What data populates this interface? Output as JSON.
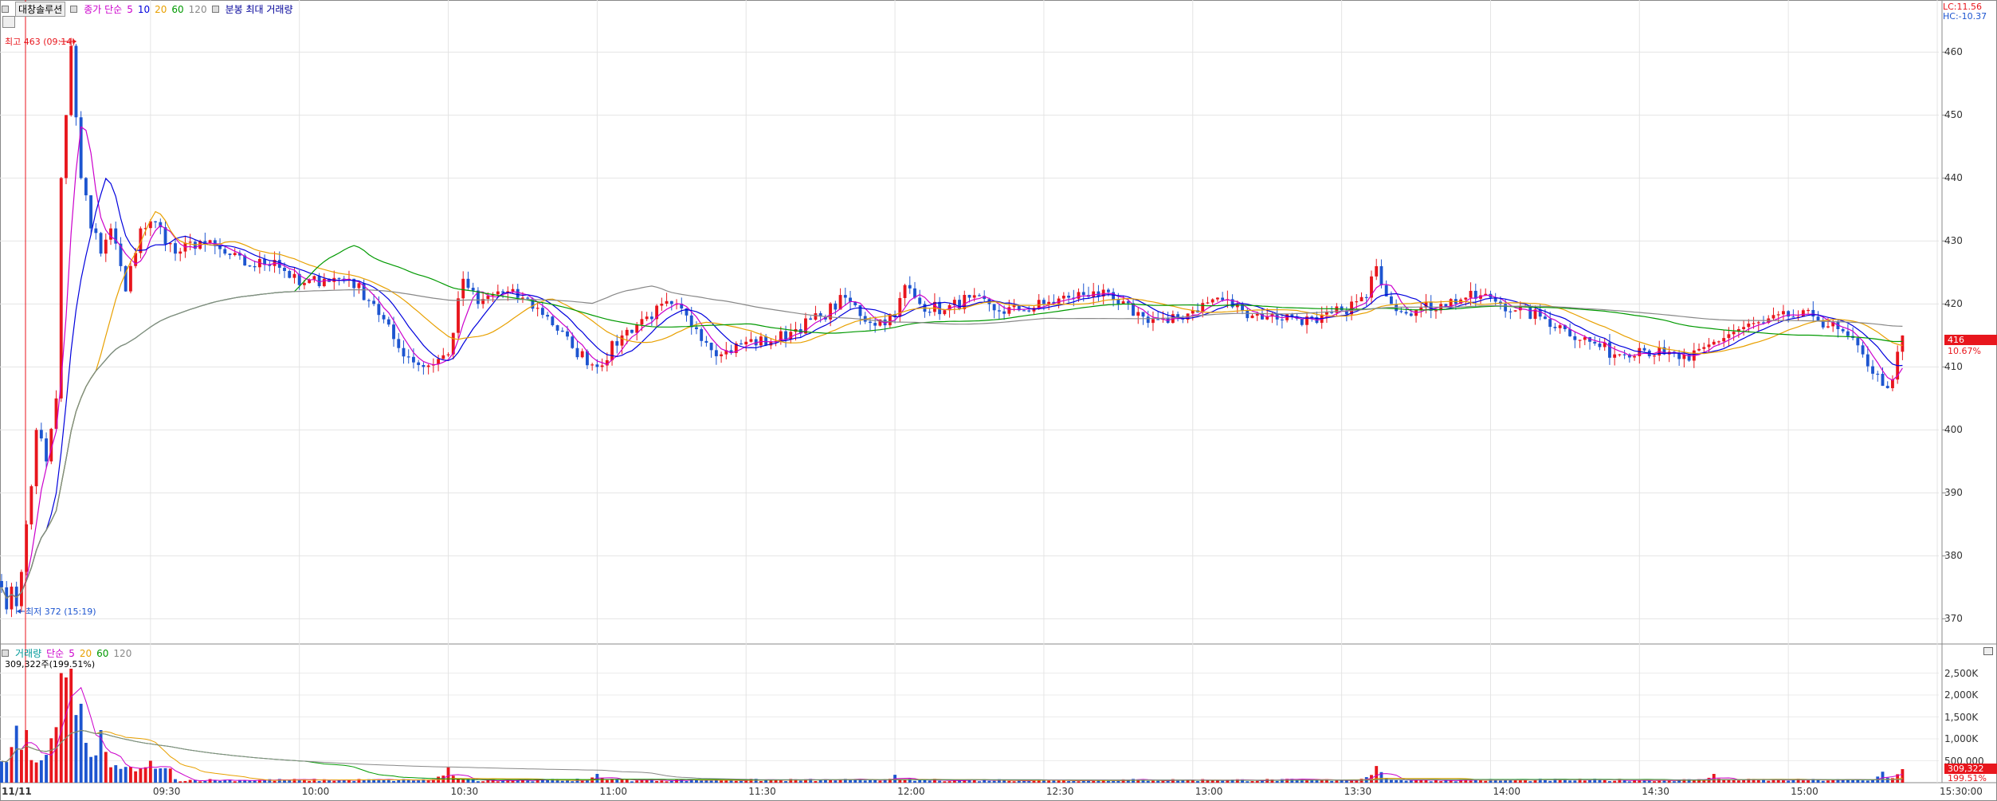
{
  "top_header": {
    "stock_name": "대창솔루션",
    "ma_label": "종가 단순",
    "ma_periods": [
      "5",
      "10",
      "20",
      "60",
      "120"
    ],
    "ma_colors": [
      "#cc00cc",
      "#0000dd",
      "#e8a000",
      "#009900",
      "#888888"
    ],
    "volume_option": "분봉 최대 거래량"
  },
  "right_info": {
    "lc": "LC:11.56",
    "hc": "HC:-10.37"
  },
  "annotations": {
    "high": "최고 463 (09:14)",
    "low": "최저 372 (15:19)"
  },
  "price_axis": {
    "ticks": [
      "460",
      "450",
      "440",
      "430",
      "420",
      "410",
      "400",
      "390",
      "380",
      "370"
    ]
  },
  "last_price": {
    "value": "416",
    "change": "10.67%"
  },
  "volume_header": {
    "label": "거래량",
    "ma_label": "단순",
    "ma_periods": [
      "5",
      "20",
      "60",
      "120"
    ],
    "current": "309,322주(199.51%)"
  },
  "volume_axis": {
    "ticks": [
      "2,500K",
      "2,000K",
      "1,500K",
      "1,000K",
      "500,000"
    ]
  },
  "last_volume": {
    "value": "309,322",
    "pct": "199.51%"
  },
  "time_axis": {
    "date": "11/11",
    "ticks": [
      "09:30",
      "10:00",
      "10:30",
      "11:00",
      "11:30",
      "12:00",
      "12:30",
      "13:00",
      "13:30",
      "14:00",
      "14:30",
      "15:00",
      "15:30:00"
    ]
  },
  "colors": {
    "up": "#e8161d",
    "down": "#1d55d0",
    "ma5": "#cc00cc",
    "ma10": "#0000dd",
    "ma20": "#e8a000",
    "ma60": "#009900",
    "ma120": "#888888"
  },
  "chart_data": {
    "type": "candlestick",
    "title": "대창솔루션",
    "xlabel": "",
    "ylabel": "",
    "ylim": [
      366,
      466
    ],
    "session": [
      "09:00",
      "15:30"
    ],
    "price_anchors": [
      [
        "09:00",
        375
      ],
      [
        "09:03",
        372
      ],
      [
        "09:05",
        385
      ],
      [
        "09:07",
        400
      ],
      [
        "09:09",
        395
      ],
      [
        "09:11",
        405
      ],
      [
        "09:12",
        440
      ],
      [
        "09:13",
        450
      ],
      [
        "09:14",
        461
      ],
      [
        "09:16",
        440
      ],
      [
        "09:18",
        432
      ],
      [
        "09:20",
        428
      ],
      [
        "09:22",
        432
      ],
      [
        "09:25",
        422
      ],
      [
        "09:28",
        432
      ],
      [
        "09:31",
        433
      ],
      [
        "09:35",
        428
      ],
      [
        "09:40",
        430
      ],
      [
        "09:45",
        428
      ],
      [
        "09:50",
        426
      ],
      [
        "09:55",
        427
      ],
      [
        "10:00",
        423
      ],
      [
        "10:05",
        424
      ],
      [
        "10:10",
        424
      ],
      [
        "10:15",
        420
      ],
      [
        "10:20",
        413
      ],
      [
        "10:25",
        410
      ],
      [
        "10:30",
        412
      ],
      [
        "10:33",
        424
      ],
      [
        "10:36",
        420
      ],
      [
        "10:40",
        422
      ],
      [
        "10:45",
        421
      ],
      [
        "10:50",
        418
      ],
      [
        "10:55",
        413
      ],
      [
        "11:00",
        410
      ],
      [
        "11:05",
        415
      ],
      [
        "11:10",
        418
      ],
      [
        "11:15",
        420
      ],
      [
        "11:20",
        416
      ],
      [
        "11:25",
        412
      ],
      [
        "11:30",
        414
      ],
      [
        "11:35",
        414
      ],
      [
        "11:40",
        416
      ],
      [
        "11:45",
        418
      ],
      [
        "11:50",
        421
      ],
      [
        "11:55",
        417
      ],
      [
        "12:00",
        418
      ],
      [
        "12:02",
        423
      ],
      [
        "12:05",
        420
      ],
      [
        "12:10",
        419
      ],
      [
        "12:15",
        421
      ],
      [
        "12:20",
        419
      ],
      [
        "12:25",
        419
      ],
      [
        "12:30",
        420
      ],
      [
        "12:35",
        421
      ],
      [
        "12:40",
        422
      ],
      [
        "12:45",
        420
      ],
      [
        "12:50",
        418
      ],
      [
        "12:55",
        417
      ],
      [
        "13:00",
        419
      ],
      [
        "13:05",
        421
      ],
      [
        "13:10",
        419
      ],
      [
        "13:15",
        418
      ],
      [
        "13:20",
        418
      ],
      [
        "13:25",
        417
      ],
      [
        "13:30",
        419
      ],
      [
        "13:35",
        421
      ],
      [
        "13:37",
        426
      ],
      [
        "13:40",
        420
      ],
      [
        "13:45",
        419
      ],
      [
        "13:50",
        420
      ],
      [
        "13:55",
        421
      ],
      [
        "14:00",
        421
      ],
      [
        "14:05",
        419
      ],
      [
        "14:10",
        418
      ],
      [
        "14:15",
        416
      ],
      [
        "14:20",
        414
      ],
      [
        "14:25",
        412
      ],
      [
        "14:30",
        413
      ],
      [
        "14:35",
        412
      ],
      [
        "14:40",
        411
      ],
      [
        "14:45",
        414
      ],
      [
        "14:50",
        416
      ],
      [
        "14:55",
        417
      ],
      [
        "15:00",
        418
      ],
      [
        "15:05",
        418
      ],
      [
        "15:10",
        416
      ],
      [
        "15:15",
        412
      ],
      [
        "15:19",
        407
      ],
      [
        "15:21",
        408
      ],
      [
        "15:23",
        415
      ]
    ],
    "moving_averages": [
      {
        "name": "5",
        "period": 5
      },
      {
        "name": "10",
        "period": 10
      },
      {
        "name": "20",
        "period": 20
      },
      {
        "name": "60",
        "period": 60
      },
      {
        "name": "120",
        "period": 120
      }
    ],
    "volume_ylim": [
      0,
      2800000
    ],
    "volume_peaks": [
      [
        "09:03",
        1300000
      ],
      [
        "09:05",
        1200000
      ],
      [
        "09:12",
        2500000
      ],
      [
        "09:13",
        2400000
      ],
      [
        "09:14",
        2600000
      ],
      [
        "09:16",
        1800000
      ],
      [
        "09:20",
        1200000
      ],
      [
        "09:30",
        500000
      ],
      [
        "10:30",
        350000
      ],
      [
        "11:00",
        200000
      ],
      [
        "12:00",
        180000
      ],
      [
        "13:37",
        380000
      ],
      [
        "14:45",
        200000
      ],
      [
        "15:19",
        250000
      ],
      [
        "15:23",
        309322
      ]
    ]
  }
}
